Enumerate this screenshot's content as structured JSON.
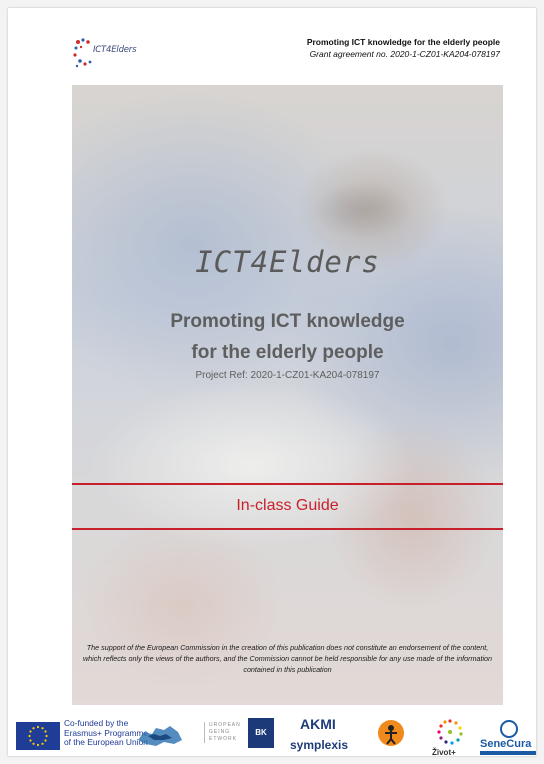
{
  "header": {
    "logo_text": "ICT4Elders",
    "title": "Promoting ICT knowledge for the elderly people",
    "grant": "Grant agreement no. 2020-1-CZ01-KA204-078197"
  },
  "cover": {
    "title": "ICT4Elders",
    "subtitle_line1": "Promoting ICT knowledge",
    "subtitle_line2": "for the elderly people",
    "project_ref": "Project Ref: 2020-1-CZ01-KA204-078197",
    "guide_label": "In-class Guide",
    "disclaimer": "The support of the European Commission in the creation of this publication does not constitute an endorsement of the content, which reflects only the views of the authors, and the Commission cannot be held responsible for any use made of the information contained in this publication"
  },
  "footer": {
    "eu_line1": "Co-funded by the",
    "eu_line2": "Erasmus+ Programme",
    "eu_line3": "of the European Union",
    "ean_line1": "UROPEAN",
    "ean_line2": "GEING",
    "ean_line3": "ETWORK",
    "bk": "BK",
    "akmi": "AKMI",
    "symplexis": "symplexis",
    "zivot": "Život+",
    "senecura": "SeneCura"
  },
  "colors": {
    "accent_red": "#c8202a",
    "eu_blue": "#1f3c96",
    "dark_blue": "#1f3d7a"
  }
}
